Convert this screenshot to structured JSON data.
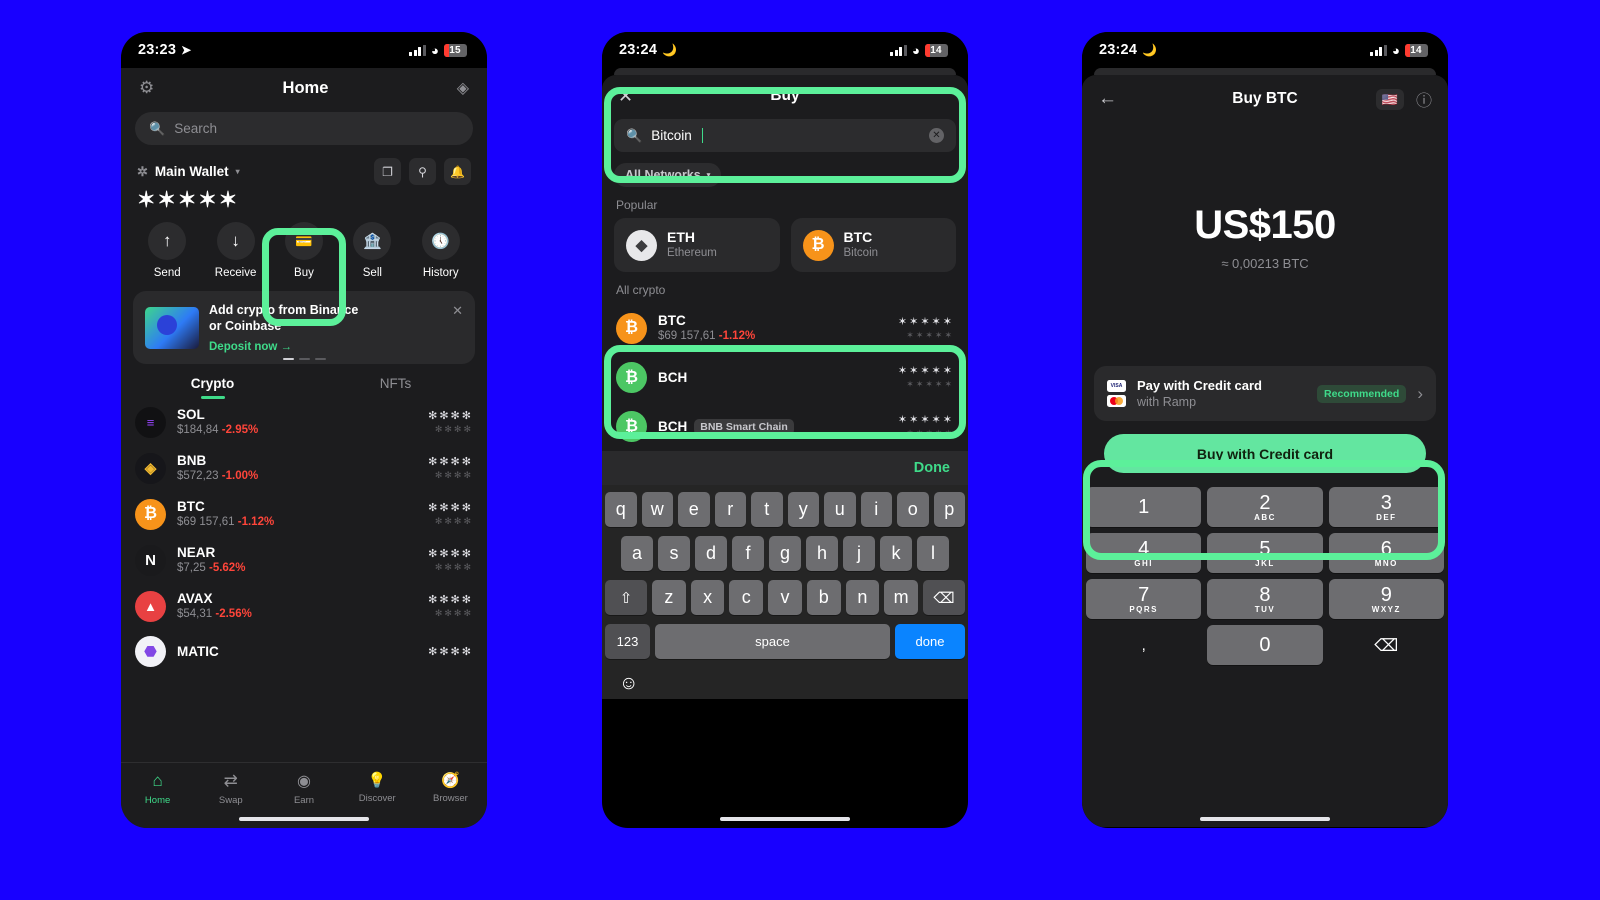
{
  "panel1": {
    "statusbar": {
      "time": "23:23",
      "location_icon": "location-arrow-icon",
      "battery": "15"
    },
    "nav": {
      "settings_icon": "gear-icon",
      "title": "Home",
      "right_icon": "scan-coins-icon"
    },
    "search": {
      "placeholder": "Search",
      "icon": "search-icon"
    },
    "wallet": {
      "name": "Main Wallet",
      "caret": "▾",
      "balance": "✶✶✶✶✶",
      "actions": [
        {
          "name": "copy-icon",
          "glyph": "❐"
        },
        {
          "name": "qr-scan-icon",
          "glyph": "⛶"
        },
        {
          "name": "bell-icon",
          "glyph": "🔔"
        }
      ]
    },
    "actions": [
      {
        "label": "Send",
        "icon": "arrow-up-icon",
        "glyph": "↑"
      },
      {
        "label": "Receive",
        "icon": "arrow-down-icon",
        "glyph": "↓"
      },
      {
        "label": "Buy",
        "icon": "credit-card-icon",
        "glyph": "▤"
      },
      {
        "label": "Sell",
        "icon": "bank-icon",
        "glyph": "🏛"
      },
      {
        "label": "History",
        "icon": "history-clock-icon",
        "glyph": "🕘"
      }
    ],
    "promo": {
      "line1": "Add crypto from Binance",
      "line2": "or Coinbase",
      "link": "Deposit now  →",
      "close": "✕"
    },
    "tabs": [
      {
        "label": "Crypto",
        "active": true
      },
      {
        "label": "NFTs",
        "active": false
      }
    ],
    "coins": [
      {
        "sym": "SOL",
        "price": "$184,84",
        "change": "-2.95%",
        "stars1": "✻✻✻✻",
        "stars2": "✻✻✻✻",
        "color": "#111113",
        "badge": "≡",
        "badge_color": "#9945ff"
      },
      {
        "sym": "BNB",
        "price": "$572,23",
        "change": "-1.00%",
        "stars1": "✻✻✻✻",
        "stars2": "✻✻✻✻",
        "color": "#16161a",
        "badge": "◈",
        "badge_color": "#f3ba2f"
      },
      {
        "sym": "BTC",
        "price": "$69 157,61",
        "change": "-1.12%",
        "stars1": "✻✻✻✻",
        "stars2": "✻✻✻✻",
        "color": "#f7931a",
        "badge": "₿",
        "badge_color": "#ffffff"
      },
      {
        "sym": "NEAR",
        "price": "$7,25",
        "change": "-5.62%",
        "stars1": "✻✻✻✻",
        "stars2": "✻✻✻✻",
        "color": "#1a1a1c",
        "badge": "N",
        "badge_color": "#ffffff"
      },
      {
        "sym": "AVAX",
        "price": "$54,31",
        "change": "-2.56%",
        "stars1": "✻✻✻✻",
        "stars2": "✻✻✻✻",
        "color": "#e84142",
        "badge": "▲",
        "badge_color": "#ffffff"
      },
      {
        "sym": "MATIC",
        "price": "",
        "change": "",
        "stars1": "✻✻✻✻",
        "stars2": "",
        "color": "#f2f2f7",
        "badge": "⬡",
        "badge_color": "#8247e5"
      }
    ],
    "tabbar": [
      {
        "label": "Home",
        "icon": "home-icon",
        "glyph": "⌂",
        "active": true
      },
      {
        "label": "Swap",
        "icon": "swap-icon",
        "glyph": "⇄",
        "active": false
      },
      {
        "label": "Earn",
        "icon": "earn-icon",
        "glyph": "◉",
        "active": false
      },
      {
        "label": "Discover",
        "icon": "bulb-icon",
        "glyph": "💡",
        "active": false
      },
      {
        "label": "Browser",
        "icon": "compass-icon",
        "glyph": "🧭",
        "active": false
      }
    ]
  },
  "panel2": {
    "statusbar": {
      "time": "23:24",
      "moon_icon": "moon-icon",
      "battery": "14"
    },
    "sheet": {
      "close": "✕",
      "title": "Buy"
    },
    "search": {
      "value": "Bitcoin",
      "icon": "search-icon",
      "clear": "✕"
    },
    "network_chip": {
      "label": "All Networks",
      "caret": "▾"
    },
    "popular_label": "Popular",
    "popular": [
      {
        "sym": "ETH",
        "name": "Ethereum",
        "color": "#e8e8ea",
        "glyph": "◆",
        "glyph_color": "#3c3c3e"
      },
      {
        "sym": "BTC",
        "name": "Bitcoin",
        "color": "#f7931a",
        "glyph": "₿",
        "glyph_color": "#ffffff"
      }
    ],
    "all_label": "All crypto",
    "rows": [
      {
        "sym": "BTC",
        "price": "$69 157,61",
        "change": "-1.12%",
        "network": "",
        "stars1": "✶✶✶✶✶",
        "stars2": "✶✶✶✶✶",
        "color": "#f7931a",
        "glyph": "₿",
        "glyph_color": "#ffffff"
      },
      {
        "sym": "BCH",
        "price": "",
        "change": "",
        "network": "",
        "stars1": "✶✶✶✶✶",
        "stars2": "✶✶✶✶✶",
        "color": "#4cc764",
        "glyph": "₿",
        "glyph_color": "#ffffff"
      },
      {
        "sym": "BCH",
        "price": "",
        "change": "",
        "network": "BNB Smart Chain",
        "stars1": "✶✶✶✶✶",
        "stars2": "✶✶✶✶✶",
        "color": "#4cc764",
        "glyph": "₿",
        "glyph_color": "#ffffff"
      }
    ],
    "done_label": "Done",
    "keyboard": {
      "row1": [
        "q",
        "w",
        "e",
        "r",
        "t",
        "y",
        "u",
        "i",
        "o",
        "p"
      ],
      "row2": [
        "a",
        "s",
        "d",
        "f",
        "g",
        "h",
        "j",
        "k",
        "l"
      ],
      "shift": "⇧",
      "row3": [
        "z",
        "x",
        "c",
        "v",
        "b",
        "n",
        "m"
      ],
      "backspace": "⌫",
      "numeric": "123",
      "space": "space",
      "done": "done",
      "emoji": "☺"
    }
  },
  "panel3": {
    "statusbar": {
      "time": "23:24",
      "moon_icon": "moon-icon",
      "battery": "14"
    },
    "nav": {
      "back": "←",
      "title": "Buy BTC",
      "flag": "🇺🇸",
      "info": "ⓘ"
    },
    "amount": "US$150",
    "amount_sub": "≈ 0,00213 BTC",
    "payment": {
      "title": "Pay with Credit card",
      "sub": "with Ramp",
      "badge": "Recommended",
      "chevron": "›"
    },
    "buy_button": "Buy with Credit card",
    "keypad": [
      [
        {
          "d": "1",
          "l": ""
        },
        {
          "d": "2",
          "l": "ABC"
        },
        {
          "d": "3",
          "l": "DEF"
        }
      ],
      [
        {
          "d": "4",
          "l": "GHI"
        },
        {
          "d": "5",
          "l": "JKL"
        },
        {
          "d": "6",
          "l": "MNO"
        }
      ],
      [
        {
          "d": "7",
          "l": "PQRS"
        },
        {
          "d": "8",
          "l": "TUV"
        },
        {
          "d": "9",
          "l": "WXYZ"
        }
      ],
      [
        {
          "d": ",",
          "l": ""
        },
        {
          "d": "0",
          "l": ""
        },
        {
          "d": "⌫",
          "l": ""
        }
      ]
    ]
  },
  "colors": {
    "highlight": "#5cf09a",
    "background": "#1800FF",
    "accent_green": "#3fdb8a",
    "negative_red": "#ff453a",
    "btc_orange": "#f7931a"
  }
}
